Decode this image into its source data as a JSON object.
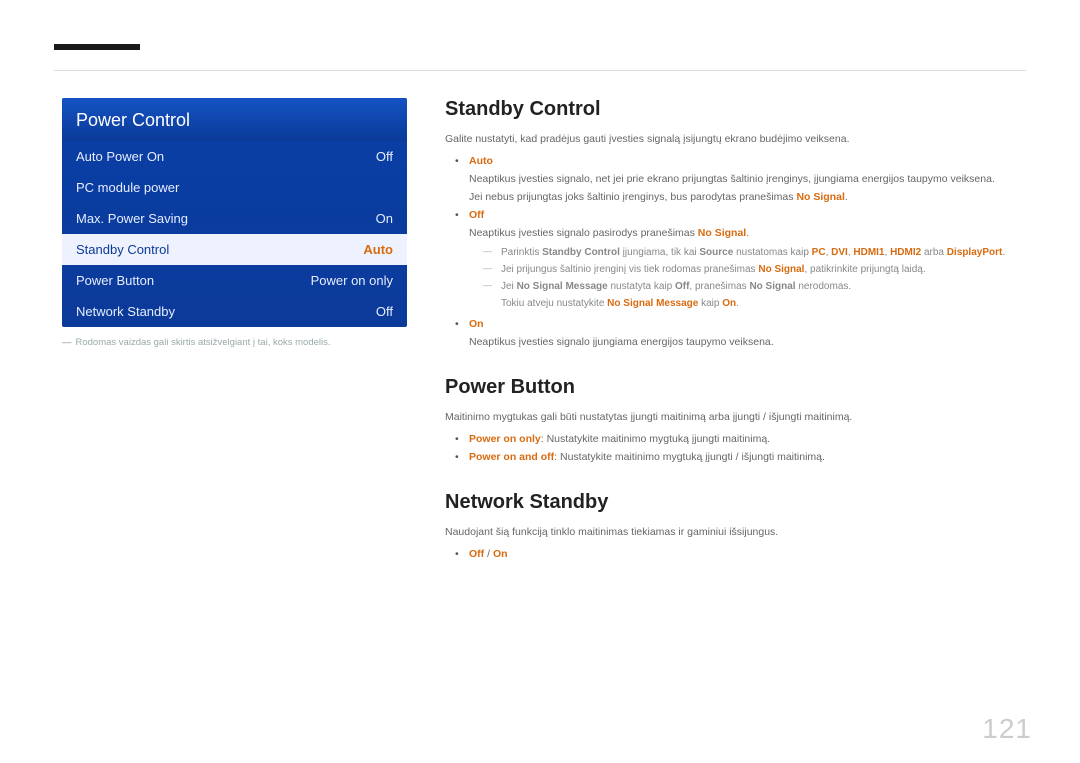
{
  "page_number": "121",
  "menu": {
    "title": "Power Control",
    "items": [
      {
        "label": "Auto Power On",
        "value": "Off"
      },
      {
        "label": "PC module power",
        "value": ""
      },
      {
        "label": "Max. Power Saving",
        "value": "On"
      },
      {
        "label": "Standby Control",
        "value": "Auto"
      },
      {
        "label": "Power Button",
        "value": "Power on only"
      },
      {
        "label": "Network Standby",
        "value": "Off"
      }
    ],
    "footnote": "Rodomas vaizdas gali skirtis atsižvelgiant į tai, koks modelis."
  },
  "sections": {
    "standby": {
      "heading": "Standby Control",
      "intro": "Galite nustatyti, kad pradėjus gauti įvesties signalą įsijungtų ekrano budėjimo veiksena.",
      "auto_label": "Auto",
      "auto_line1": "Neaptikus įvesties signalo, net jei prie ekrano prijungtas šaltinio įrenginys, įjungiama energijos taupymo veiksena.",
      "auto_line2_a": "Jei nebus prijungtas joks šaltinio įrenginys, bus parodytas pranešimas ",
      "auto_line2_b": "No Signal",
      "auto_line2_c": ".",
      "off_label": "Off",
      "off_line_a": "Neaptikus įvesties signalo pasirodys pranešimas ",
      "off_line_b": "No Signal",
      "off_line_c": ".",
      "off_sub1_a": "Parinktis ",
      "off_sub1_b": "Standby Control",
      "off_sub1_c": " įjungiama, tik kai ",
      "off_sub1_d": "Source",
      "off_sub1_e": " nustatomas kaip ",
      "off_sub1_pc": "PC",
      "off_sub1_dvi": "DVI",
      "off_sub1_h1": "HDMI1",
      "off_sub1_h2": "HDMI2",
      "off_sub1_arba": " arba ",
      "off_sub1_dp": "DisplayPort",
      "off_sub1_end": ".",
      "off_sub2_a": "Jei prijungus šaltinio įrenginį vis tiek rodomas pranešimas ",
      "off_sub2_b": "No Signal",
      "off_sub2_c": ", patikrinkite prijungtą laidą.",
      "off_sub3_a": "Jei ",
      "off_sub3_b": "No Signal Message",
      "off_sub3_c": " nustatyta kaip ",
      "off_sub3_d": "Off",
      "off_sub3_e": ", pranešimas ",
      "off_sub3_f": "No Signal",
      "off_sub3_g": " nerodomas.",
      "off_sub3_h": "Tokiu atveju nustatykite ",
      "off_sub3_i": "No Signal Message",
      "off_sub3_j": " kaip ",
      "off_sub3_k": "On",
      "off_sub3_l": ".",
      "on_label": "On",
      "on_line": "Neaptikus įvesties signalo įjungiama energijos taupymo veiksena."
    },
    "powerbutton": {
      "heading": "Power Button",
      "intro": "Maitinimo mygtukas gali būti nustatytas įjungti maitinimą arba įjungti / išjungti maitinimą.",
      "b1_a": "Power on only",
      "b1_b": ": Nustatykite maitinimo mygtuką įjungti maitinimą.",
      "b2_a": "Power on and off",
      "b2_b": ": Nustatykite maitinimo mygtuką įjungti / išjungti maitinimą."
    },
    "network": {
      "heading": "Network Standby",
      "intro": "Naudojant šią funkciją tinklo maitinimas tiekiamas ir gaminiui išsijungus.",
      "opt_a": "Off",
      "opt_sep": " / ",
      "opt_b": "On"
    }
  }
}
